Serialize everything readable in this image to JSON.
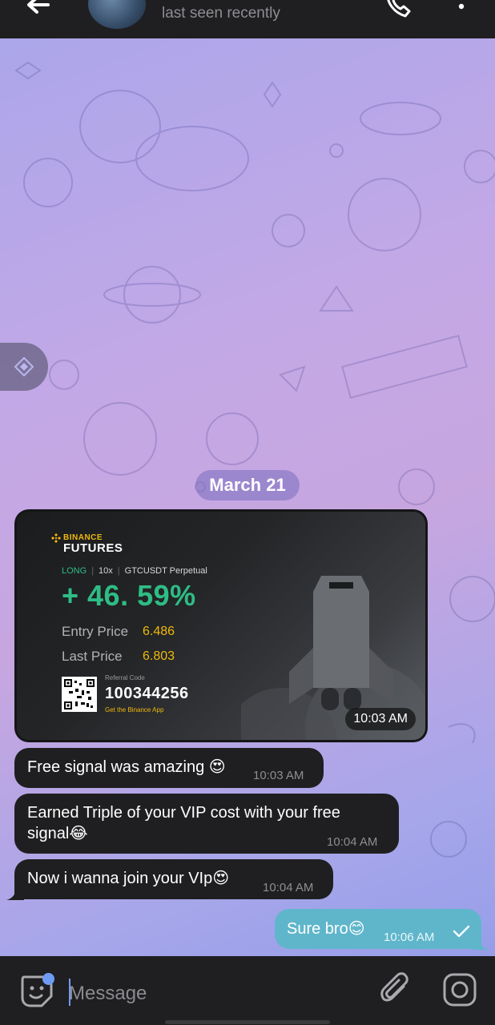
{
  "header": {
    "status": "last seen recently",
    "icons": [
      "back-arrow-icon",
      "phone-icon",
      "more-vertical-icon"
    ]
  },
  "chat": {
    "date_chip": "March 21",
    "card": {
      "brand": "BINANCE",
      "brand_sub": "FUTURES",
      "side": "LONG",
      "leverage": "10x",
      "pair": "GTCUSDT Perpetual",
      "pnl": "+ 46. 59%",
      "entry_label": "Entry Price",
      "entry_value": "6.486",
      "last_label": "Last Price",
      "last_value": "6.803",
      "referral_label": "Referral Code",
      "referral_code": "100344256",
      "app_text": "Get the Binance App",
      "time": "10:03 AM"
    },
    "incoming": [
      {
        "text": "Free signal was amazing 😍",
        "time": "10:03 AM"
      },
      {
        "text": "Earned Triple of your VIP cost with your free signal😂",
        "time": "10:04 AM"
      },
      {
        "text": "Now i wanna join your VIp😍",
        "time": "10:04 AM"
      }
    ],
    "outgoing": [
      {
        "text": "Sure bro😊",
        "time": "10:06 AM",
        "status": "sent"
      }
    ]
  },
  "composer": {
    "placeholder": "Message",
    "icons": [
      "sticker-emoji-icon",
      "attach-icon",
      "camera-icon"
    ]
  },
  "colors": {
    "bubble_in": "#1f1f21",
    "bubble_out": "#5fb6cb",
    "accent_green": "#2ebd85",
    "binance_yellow": "#f0b90b",
    "cursor_blue": "#6f9cf2"
  }
}
